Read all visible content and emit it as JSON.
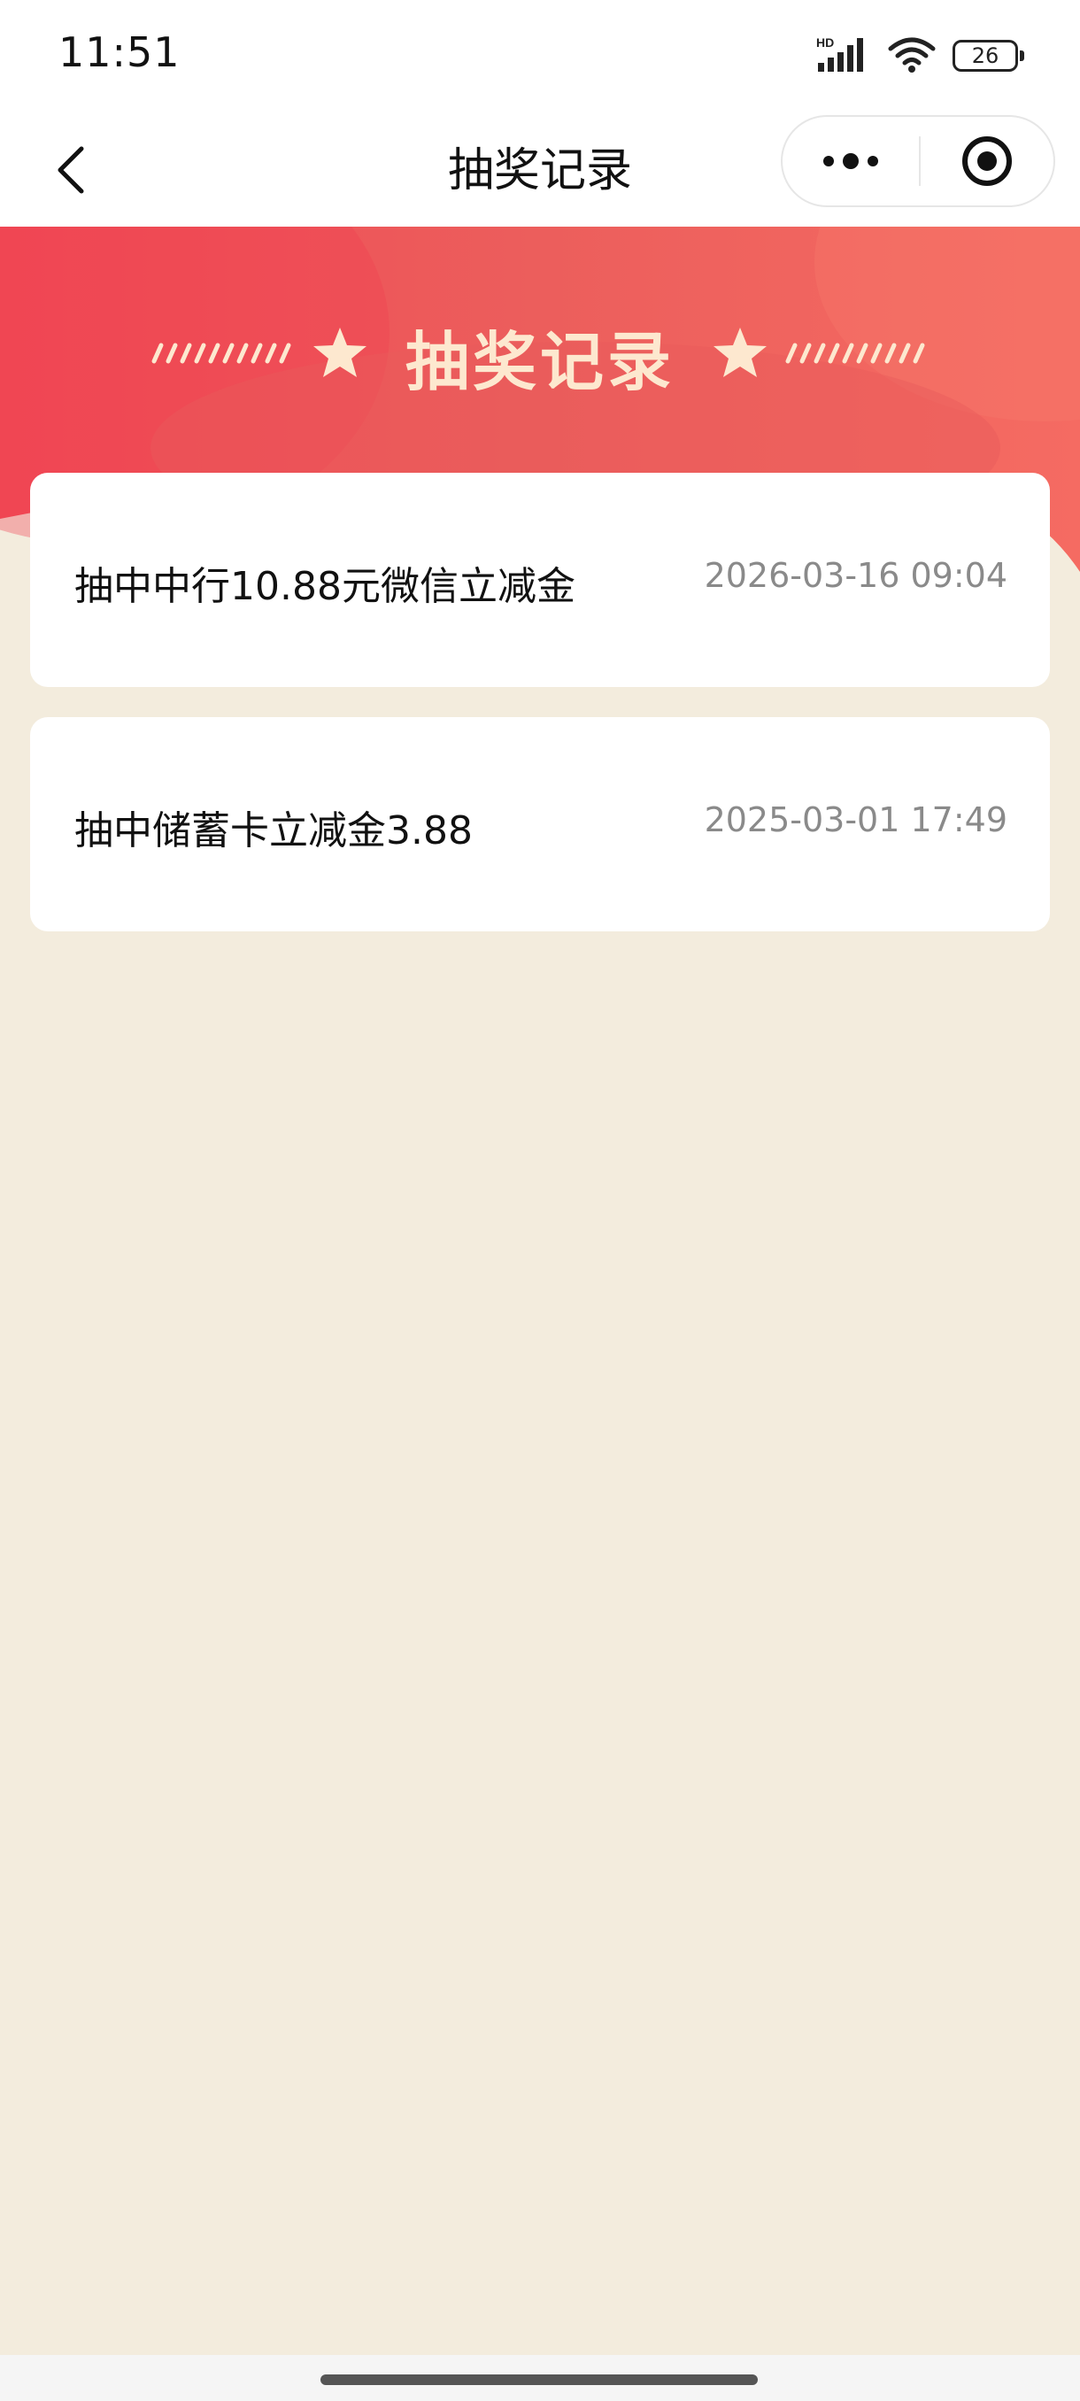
{
  "status_bar": {
    "time": "11:51",
    "network_label": "HD",
    "battery_level": "26",
    "icons": [
      "signal-icon",
      "wifi-icon",
      "battery-icon"
    ]
  },
  "nav": {
    "title": "抽奖记录",
    "icons": [
      "back-icon",
      "more-icon",
      "close-target-icon"
    ]
  },
  "banner": {
    "title": "抽奖记录",
    "gradient_colors": [
      "#f04a55",
      "#ef6a5e"
    ],
    "title_color": "#fde8cf"
  },
  "records": [
    {
      "title": "抽中中行10.88元微信立减金",
      "time": "2026-03-16 09:04"
    },
    {
      "title": "抽中储蓄卡立减金3.88",
      "time": "2025-03-01 17:49"
    }
  ],
  "colors": {
    "page_background": "#f3ecdd",
    "card_background": "#ffffff",
    "time_text": "#8a8a8a"
  }
}
